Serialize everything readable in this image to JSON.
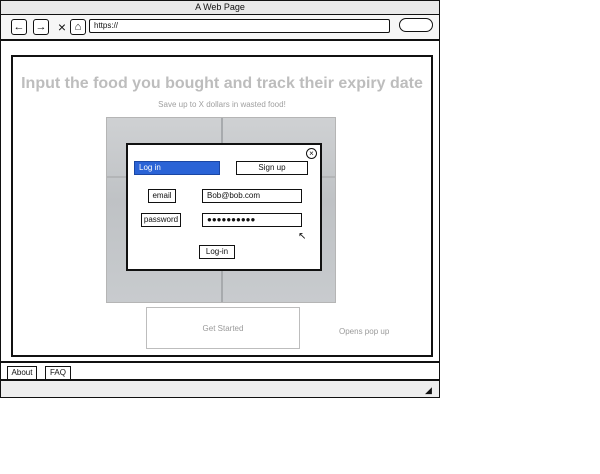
{
  "window": {
    "title": "A Web Page"
  },
  "toolbar": {
    "icons": {
      "back": "arrow-left-icon",
      "forward": "arrow-right-icon",
      "stop": "close-icon",
      "home": "home-icon"
    },
    "url": "https://"
  },
  "hero": {
    "headline": "Input the food you bought and track their expiry date",
    "subline": "Save up to X dollars in wasted food!"
  },
  "modal": {
    "tabs": [
      {
        "label": "Log in",
        "selected": true
      },
      {
        "label": "Sign up",
        "selected": false
      }
    ],
    "fields": {
      "email": {
        "label": "email",
        "value": "Bob@bob.com"
      },
      "password": {
        "label": "password",
        "value": "●●●●●●●●●●"
      }
    },
    "submit_label": "Log-in"
  },
  "cta": {
    "button_label": "Get Started",
    "note": "Opens pop up"
  },
  "footer": {
    "links": [
      "About",
      "FAQ"
    ]
  },
  "colors": {
    "accent": "#2a63d6",
    "muted_text": "#bdbdbd",
    "border": "#111111"
  }
}
